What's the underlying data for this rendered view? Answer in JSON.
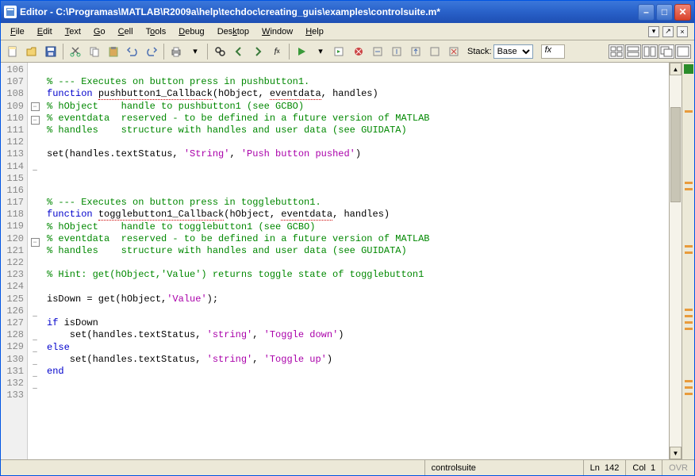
{
  "titlebar": {
    "title": "Editor - C:\\Programas\\MATLAB\\R2009a\\help\\techdoc\\creating_guis\\examples\\controlsuite.m*"
  },
  "menus": {
    "file": "File",
    "edit": "Edit",
    "text": "Text",
    "go": "Go",
    "cell": "Cell",
    "tools": "Tools",
    "debug": "Debug",
    "desktop": "Desktop",
    "window": "Window",
    "help": "Help"
  },
  "toolbar": {
    "stack_label": "Stack:",
    "stack_value": "Base",
    "fx": "fx"
  },
  "gutter_start": 106,
  "code": {
    "l107": "% --- Executes on button press in pushbutton1.",
    "l108_kw": "function",
    "l108_fn": "pushbutton1_Callback",
    "l108_args": "(hObject, ",
    "l108_ev": "eventdata",
    "l108_rest": ", handles)",
    "l109": "% hObject    handle to pushbutton1 (see GCBO)",
    "l110": "% eventdata  reserved - to be defined in a future version of MATLAB",
    "l111": "% handles    structure with handles and user data (see GUIDATA)",
    "l113a": "set(handles.textStatus, ",
    "l113s1": "'String'",
    "l113b": ", ",
    "l113s2": "'Push button pushed'",
    "l113c": ")",
    "l117": "% --- Executes on button press in togglebutton1.",
    "l118_kw": "function",
    "l118_fn": "togglebutton1_Callback",
    "l118_args": "(hObject, ",
    "l118_ev": "eventdata",
    "l118_rest": ", handles)",
    "l119": "% hObject    handle to togglebutton1 (see GCBO)",
    "l120": "% eventdata  reserved - to be defined in a future version of MATLAB",
    "l121": "% handles    structure with handles and user data (see GUIDATA)",
    "l123": "% Hint: get(hObject,'Value') returns toggle state of togglebutton1",
    "l125a": "isDown = get(hObject,",
    "l125s": "'Value'",
    "l125b": ");",
    "l127_kw": "if",
    "l127_rest": " isDown",
    "l128a": "    set(handles.textStatus, ",
    "l128s1": "'string'",
    "l128b": ", ",
    "l128s2": "'Toggle down'",
    "l128c": ")",
    "l129_kw": "else",
    "l130a": "    set(handles.textStatus, ",
    "l130s1": "'string'",
    "l130b": ", ",
    "l130s2": "'Toggle up'",
    "l130c": ")",
    "l131_kw": "end"
  },
  "status": {
    "filename": "controlsuite",
    "ln": "Ln",
    "ln_val": "142",
    "col": "Col",
    "col_val": "1",
    "ovr": "OVR"
  }
}
